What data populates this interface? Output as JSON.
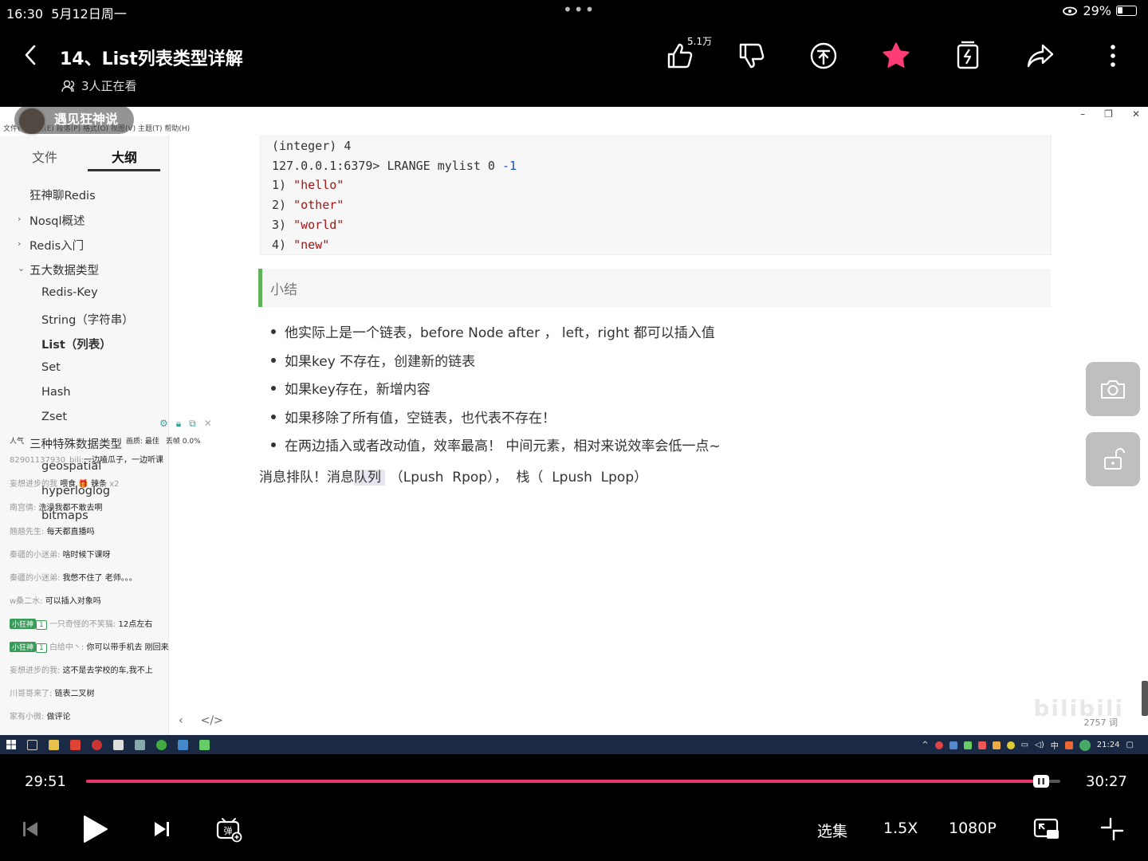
{
  "status_bar": {
    "time": "16:30",
    "date": "5月12日周一",
    "battery": "29%"
  },
  "header": {
    "title": "14、List列表类型详解",
    "viewers": "3人正在看",
    "like_count": "5.1万"
  },
  "video": {
    "uploader": "遇见狂神说",
    "menu": "文件(F) 编辑(E) 段落(P) 格式(O) 视图(V) 主题(T) 帮助(H)",
    "tabs": {
      "files": "文件",
      "outline": "大纲"
    },
    "outline": [
      "狂神聊Redis",
      "Nosql概述",
      "Redis入门",
      "五大数据类型",
      "Redis-Key",
      "String（字符串）",
      "List（列表）",
      "Set",
      "Hash",
      "Zset",
      "三种特殊数据类型",
      "geospatial",
      "hyperloglog",
      "bitmaps"
    ],
    "live_stats": {
      "popularity": "人气",
      "quality_label": "画质: 最佳",
      "frame_drop": "丢帧 0.0%"
    },
    "chat": [
      {
        "user": "82901137930_bili:",
        "text": "一边嗑瓜子，一边听课"
      },
      {
        "user": "妄想进步的我",
        "text": "喂食",
        "extra": "辣条",
        "count": "x2"
      },
      {
        "user": "南宫倩:",
        "text": "洗澡我都不敢去啊"
      },
      {
        "user": "翘翘先生:",
        "text": "每天都直播吗"
      },
      {
        "user": "秦疆的小迷弟:",
        "text": "啥时候下课呀"
      },
      {
        "user": "秦疆的小迷弟:",
        "text": "我憋不住了 老师。。。"
      },
      {
        "user": "w桑二水:",
        "text": "可以插入对象吗"
      },
      {
        "tag": "小狂神",
        "level": "1",
        "user": "一只奇怪的不笑猫:",
        "text": "12点左右"
      },
      {
        "tag": "小狂神",
        "level": "1",
        "user": "白给中丶:",
        "text": "你可以带手机去  刚回来"
      },
      {
        "user": "妄想进步的我:",
        "text": "这不是去学校的车,我不上"
      },
      {
        "user": "川哥哥来了:",
        "text": "链表二叉树"
      },
      {
        "user": "家有小微:",
        "text": "做评论"
      }
    ],
    "code": {
      "l1a": "(integer) ",
      "l1b": "4",
      "l2a": "127.0.0.1:6379> LRANGE mylist 0 ",
      "l2b": "-1",
      "l3a": "1) ",
      "l3b": "\"hello\"",
      "l4a": "2) ",
      "l4b": "\"other\"",
      "l5a": "3) ",
      "l5b": "\"world\"",
      "l6a": "4) ",
      "l6b": "\"new\""
    },
    "summary_title": "小结",
    "bullets": [
      "他实际上是一个链表，before Node after ， left，right 都可以插入值",
      "如果key 不存在，创建新的链表",
      "如果key存在，新增内容",
      "如果移除了所有值，空链表，也代表不存在！",
      "在两边插入或者改动值，效率最高！ 中间元素，相对来说效率会低一点~"
    ],
    "queue_pre": "消息排队！消息",
    "queue_sel": "队列 ",
    "queue_post": " （Lpush  Rpop），  栈（  Lpush  Lpop）",
    "watermark": "bilibili",
    "word_count": "2757 词",
    "taskbar_time": "21:24",
    "taskbar_lang": "中"
  },
  "player": {
    "current_time": "29:51",
    "total_time": "30:27",
    "progress": 0.98,
    "episodes": "选集",
    "speed": "1.5X",
    "quality": "1080P"
  },
  "colors": {
    "accent": "#e8386b",
    "star": "#ff3d74",
    "quote_border": "#5fb35b"
  }
}
